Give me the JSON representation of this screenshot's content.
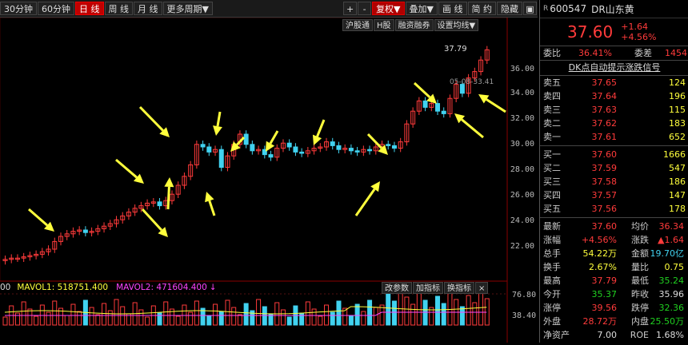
{
  "toolbar": {
    "buttons": [
      "30分钟",
      "60分钟",
      "日 线",
      "周 线",
      "月 线",
      "更多周期▼"
    ],
    "right_buttons": [
      "+",
      "-",
      "复权▼",
      "叠加▼",
      "画 线",
      "简 约",
      "隐藏"
    ],
    "chart_tools": [
      "沪股通",
      "H股",
      "融资融券",
      "设置均线▼"
    ]
  },
  "chart": {
    "axis_labels": [
      "36.00",
      "34.00",
      "32.00",
      "30.00",
      "28.00",
      "26.00",
      "24.00",
      "22.00"
    ],
    "high_label": "37.79",
    "date_tag": "05-08-33.41",
    "vol_axis_labels": [
      "76.80",
      "38.40"
    ],
    "vol_legend": {
      "prefix": "00",
      "mavol1": "MAVOL1: 518751.400",
      "mavol2": "MAVOL2: 471604.400"
    },
    "vol_buttons": [
      "改参数",
      "加指标",
      "换指标",
      "×"
    ]
  },
  "quote": {
    "code": "600547",
    "name": "DR山东黄",
    "price": "37.60",
    "change": "+1.64",
    "change_pct": "+4.56%",
    "weibi_label": "委比",
    "weibi": "36.41%",
    "weicha_label": "委差",
    "weicha": "1454",
    "signal": "DK点自动提示涨跌信号",
    "asks": [
      {
        "label": "卖五",
        "price": "37.65",
        "vol": "124"
      },
      {
        "label": "卖四",
        "price": "37.64",
        "vol": "196"
      },
      {
        "label": "卖三",
        "price": "37.63",
        "vol": "115"
      },
      {
        "label": "卖二",
        "price": "37.62",
        "vol": "183"
      },
      {
        "label": "卖一",
        "price": "37.61",
        "vol": "652"
      }
    ],
    "bids": [
      {
        "label": "买一",
        "price": "37.60",
        "vol": "1666"
      },
      {
        "label": "买二",
        "price": "37.59",
        "vol": "547"
      },
      {
        "label": "买三",
        "price": "37.58",
        "vol": "186"
      },
      {
        "label": "买四",
        "price": "37.57",
        "vol": "147"
      },
      {
        "label": "买五",
        "price": "37.56",
        "vol": "178"
      }
    ],
    "stats": [
      {
        "l1": "最新",
        "v1": "37.60",
        "c1": "red",
        "l2": "均价",
        "v2": "36.34",
        "c2": "red"
      },
      {
        "l1": "涨幅",
        "v1": "+4.56%",
        "c1": "red",
        "l2": "涨跌",
        "v2": "▲1.64",
        "c2": "red"
      },
      {
        "l1": "总手",
        "v1": "54.22万",
        "c1": "yellow",
        "l2": "金额",
        "v2": "19.70亿",
        "c2": "cyan"
      },
      {
        "l1": "换手",
        "v1": "2.67%",
        "c1": "yellow",
        "l2": "量比",
        "v2": "0.75",
        "c2": "yellow"
      },
      {
        "l1": "最高",
        "v1": "37.79",
        "c1": "red",
        "l2": "最低",
        "v2": "35.24",
        "c2": "green"
      },
      {
        "l1": "今开",
        "v1": "35.37",
        "c1": "green",
        "l2": "昨收",
        "v2": "35.96",
        "c2": "white"
      },
      {
        "l1": "涨停",
        "v1": "39.56",
        "c1": "red",
        "l2": "跌停",
        "v2": "32.36",
        "c2": "green"
      },
      {
        "l1": "外盘",
        "v1": "28.72万",
        "c1": "red",
        "l2": "内盘",
        "v2": "25.50万",
        "c2": "green"
      },
      {
        "l1": "净资产",
        "v1": "7.00",
        "c1": "white",
        "l2": "ROE",
        "v2": "1.68%",
        "c2": "white"
      }
    ]
  },
  "colors": {
    "up": "#ff3b3b",
    "down": "#41d2f0",
    "arrow": "#ffff3c",
    "mavol1": "#ffff3c",
    "mavol2": "#ff44ff"
  }
}
